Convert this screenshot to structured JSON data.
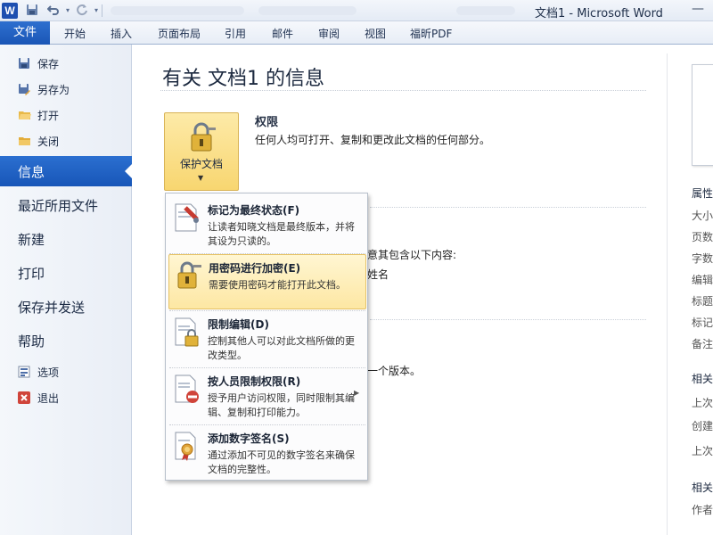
{
  "window": {
    "title": "文档1 - Microsoft Word",
    "logo": "W"
  },
  "quick_access": {
    "save_icon": "save-icon",
    "undo_icon": "undo-icon",
    "redo_icon": "redo-icon"
  },
  "ribbon": {
    "file_tab": "文件",
    "tabs": [
      "开始",
      "插入",
      "页面布局",
      "引用",
      "邮件",
      "审阅",
      "视图",
      "福昕PDF"
    ]
  },
  "backstage_nav": {
    "small_top": [
      {
        "label": "保存",
        "icon": "save-icon"
      },
      {
        "label": "另存为",
        "icon": "save-as-icon"
      },
      {
        "label": "打开",
        "icon": "open-folder-icon"
      },
      {
        "label": "关闭",
        "icon": "close-folder-icon"
      }
    ],
    "info": "信息",
    "big": [
      "最近所用文件",
      "新建",
      "打印",
      "保存并发送",
      "帮助"
    ],
    "small_bottom": [
      {
        "label": "选项",
        "icon": "options-icon"
      },
      {
        "label": "退出",
        "icon": "exit-icon"
      }
    ]
  },
  "main": {
    "title": "有关 文档1 的信息",
    "protect_button": "保护文档",
    "permissions_title": "权限",
    "permissions_desc": "任何人均可打开、复制和更改此文档的任何部分。",
    "behind_fragments": [
      "意其包含以下内容:",
      "姓名",
      "一个版本。"
    ]
  },
  "protect_menu": {
    "items": [
      {
        "title": "标记为最终状态(F)",
        "desc": "让读者知晓文档是最终版本，并将其设为只读的。",
        "icon": "mark-final-icon",
        "selected": false
      },
      {
        "title": "用密码进行加密(E)",
        "desc": "需要使用密码才能打开此文档。",
        "icon": "password-lock-icon",
        "selected": true
      },
      {
        "title": "限制编辑(D)",
        "desc": "控制其他人可以对此文档所做的更改类型。",
        "icon": "restrict-editing-icon",
        "selected": false
      },
      {
        "title": "按人员限制权限(R)",
        "desc": "授予用户访问权限，同时限制其编辑、复制和打印能力。",
        "icon": "restrict-permission-icon",
        "selected": false
      },
      {
        "title": "添加数字签名(S)",
        "desc": "通过添加不可见的数字签名来确保文档的完整性。",
        "icon": "digital-signature-icon",
        "selected": false
      }
    ]
  },
  "right_panel": {
    "properties_heading": "属性",
    "property_labels": [
      "大小",
      "页数",
      "字数",
      "编辑",
      "标题",
      "标记",
      "备注"
    ],
    "related_dates_heading": "相关",
    "date_labels": [
      "上次",
      "创建",
      "上次"
    ],
    "related_people_heading": "相关",
    "people_labels": [
      "作者"
    ]
  }
}
